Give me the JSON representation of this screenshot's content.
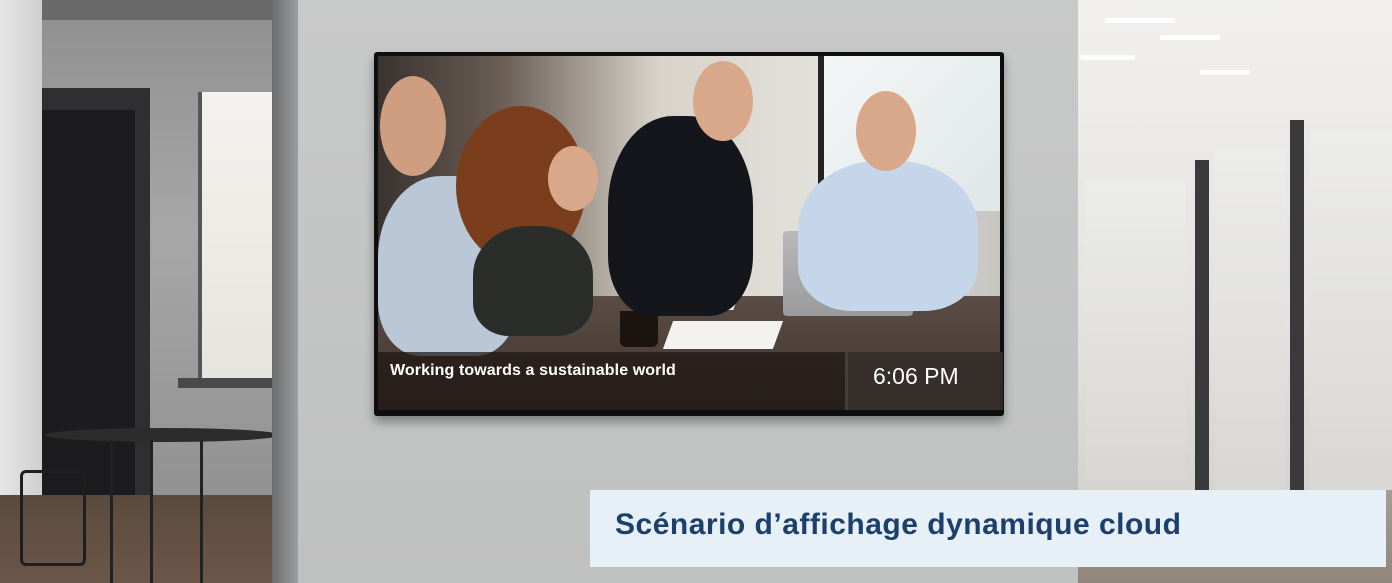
{
  "signage": {
    "caption": "Working towards a sustainable world",
    "clock": "6:06 PM"
  },
  "banner": {
    "title": "Scénario d’affichage dynamique cloud"
  },
  "colors": {
    "banner_background": "#e6f0f6",
    "banner_text": "#1c3f6b"
  }
}
